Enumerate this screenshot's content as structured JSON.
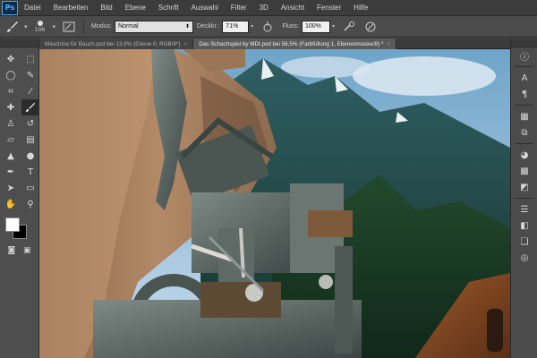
{
  "app": {
    "logo": "Ps",
    "menu": [
      "Datei",
      "Bearbeiten",
      "Bild",
      "Ebene",
      "Schrift",
      "Auswahl",
      "Filter",
      "3D",
      "Ansicht",
      "Fenster",
      "Hilfe"
    ]
  },
  "options": {
    "brush_size": "106",
    "mode_label": "Modus:",
    "mode_value": "Normal",
    "opacity_label": "Deckkr.:",
    "opacity_value": "71%",
    "flow_label": "Fluss:",
    "flow_value": "100%"
  },
  "tabs": [
    {
      "label": "Maschine für Bauch.psd bei 13,9% (Ebene 0, RGB/8*)",
      "active": false
    },
    {
      "label": "Das Schachspiel by MDI.psd bei 56,5% (Farbfüllung 1, Ebenenmaske/8) *",
      "active": true
    }
  ],
  "colors": {
    "foreground": "#ffffff",
    "background": "#000000"
  }
}
